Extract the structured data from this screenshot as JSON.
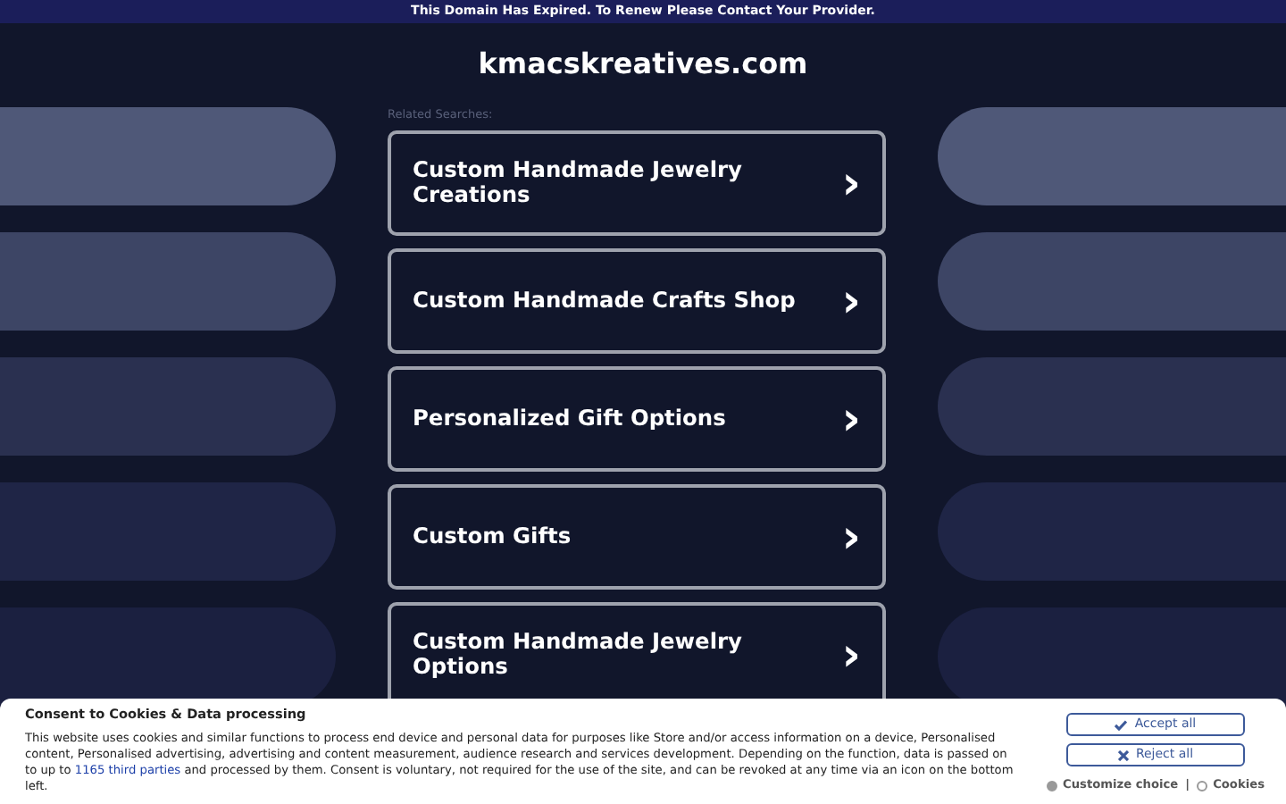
{
  "top_banner": "This Domain Has Expired. To Renew Please Contact Your Provider.",
  "domain": "kmacskreatives.com",
  "related_label": "Related Searches:",
  "links": [
    {
      "label": "Custom Handmade Jewelry Creations",
      "arrow": "›"
    },
    {
      "label": "Custom Handmade Crafts Shop",
      "arrow": "›"
    },
    {
      "label": "Personalized Gift Options",
      "arrow": "›"
    },
    {
      "label": "Custom Gifts",
      "arrow": "›"
    },
    {
      "label": "Custom Handmade Jewelry Options",
      "arrow": "›"
    }
  ],
  "consent": {
    "title": "Consent to Cookies & Data processing",
    "text_before": "This website uses cookies and similar functions to process end device and personal data for purposes like Store and/or access information on a device, Personalised content, Personalised advertising, advertising and content measurement, audience research and services development. Depending on the function, data is passed on to up to ",
    "link": "1165 third parties",
    "text_after": " and processed by them. Consent is voluntary, not required for the use of the site, and can be revoked at any time via an icon on the bottom left.",
    "accept": "Accept all",
    "reject": "Reject all",
    "customize": "Customize choice",
    "separator": "|",
    "cookies": "Cookies"
  }
}
